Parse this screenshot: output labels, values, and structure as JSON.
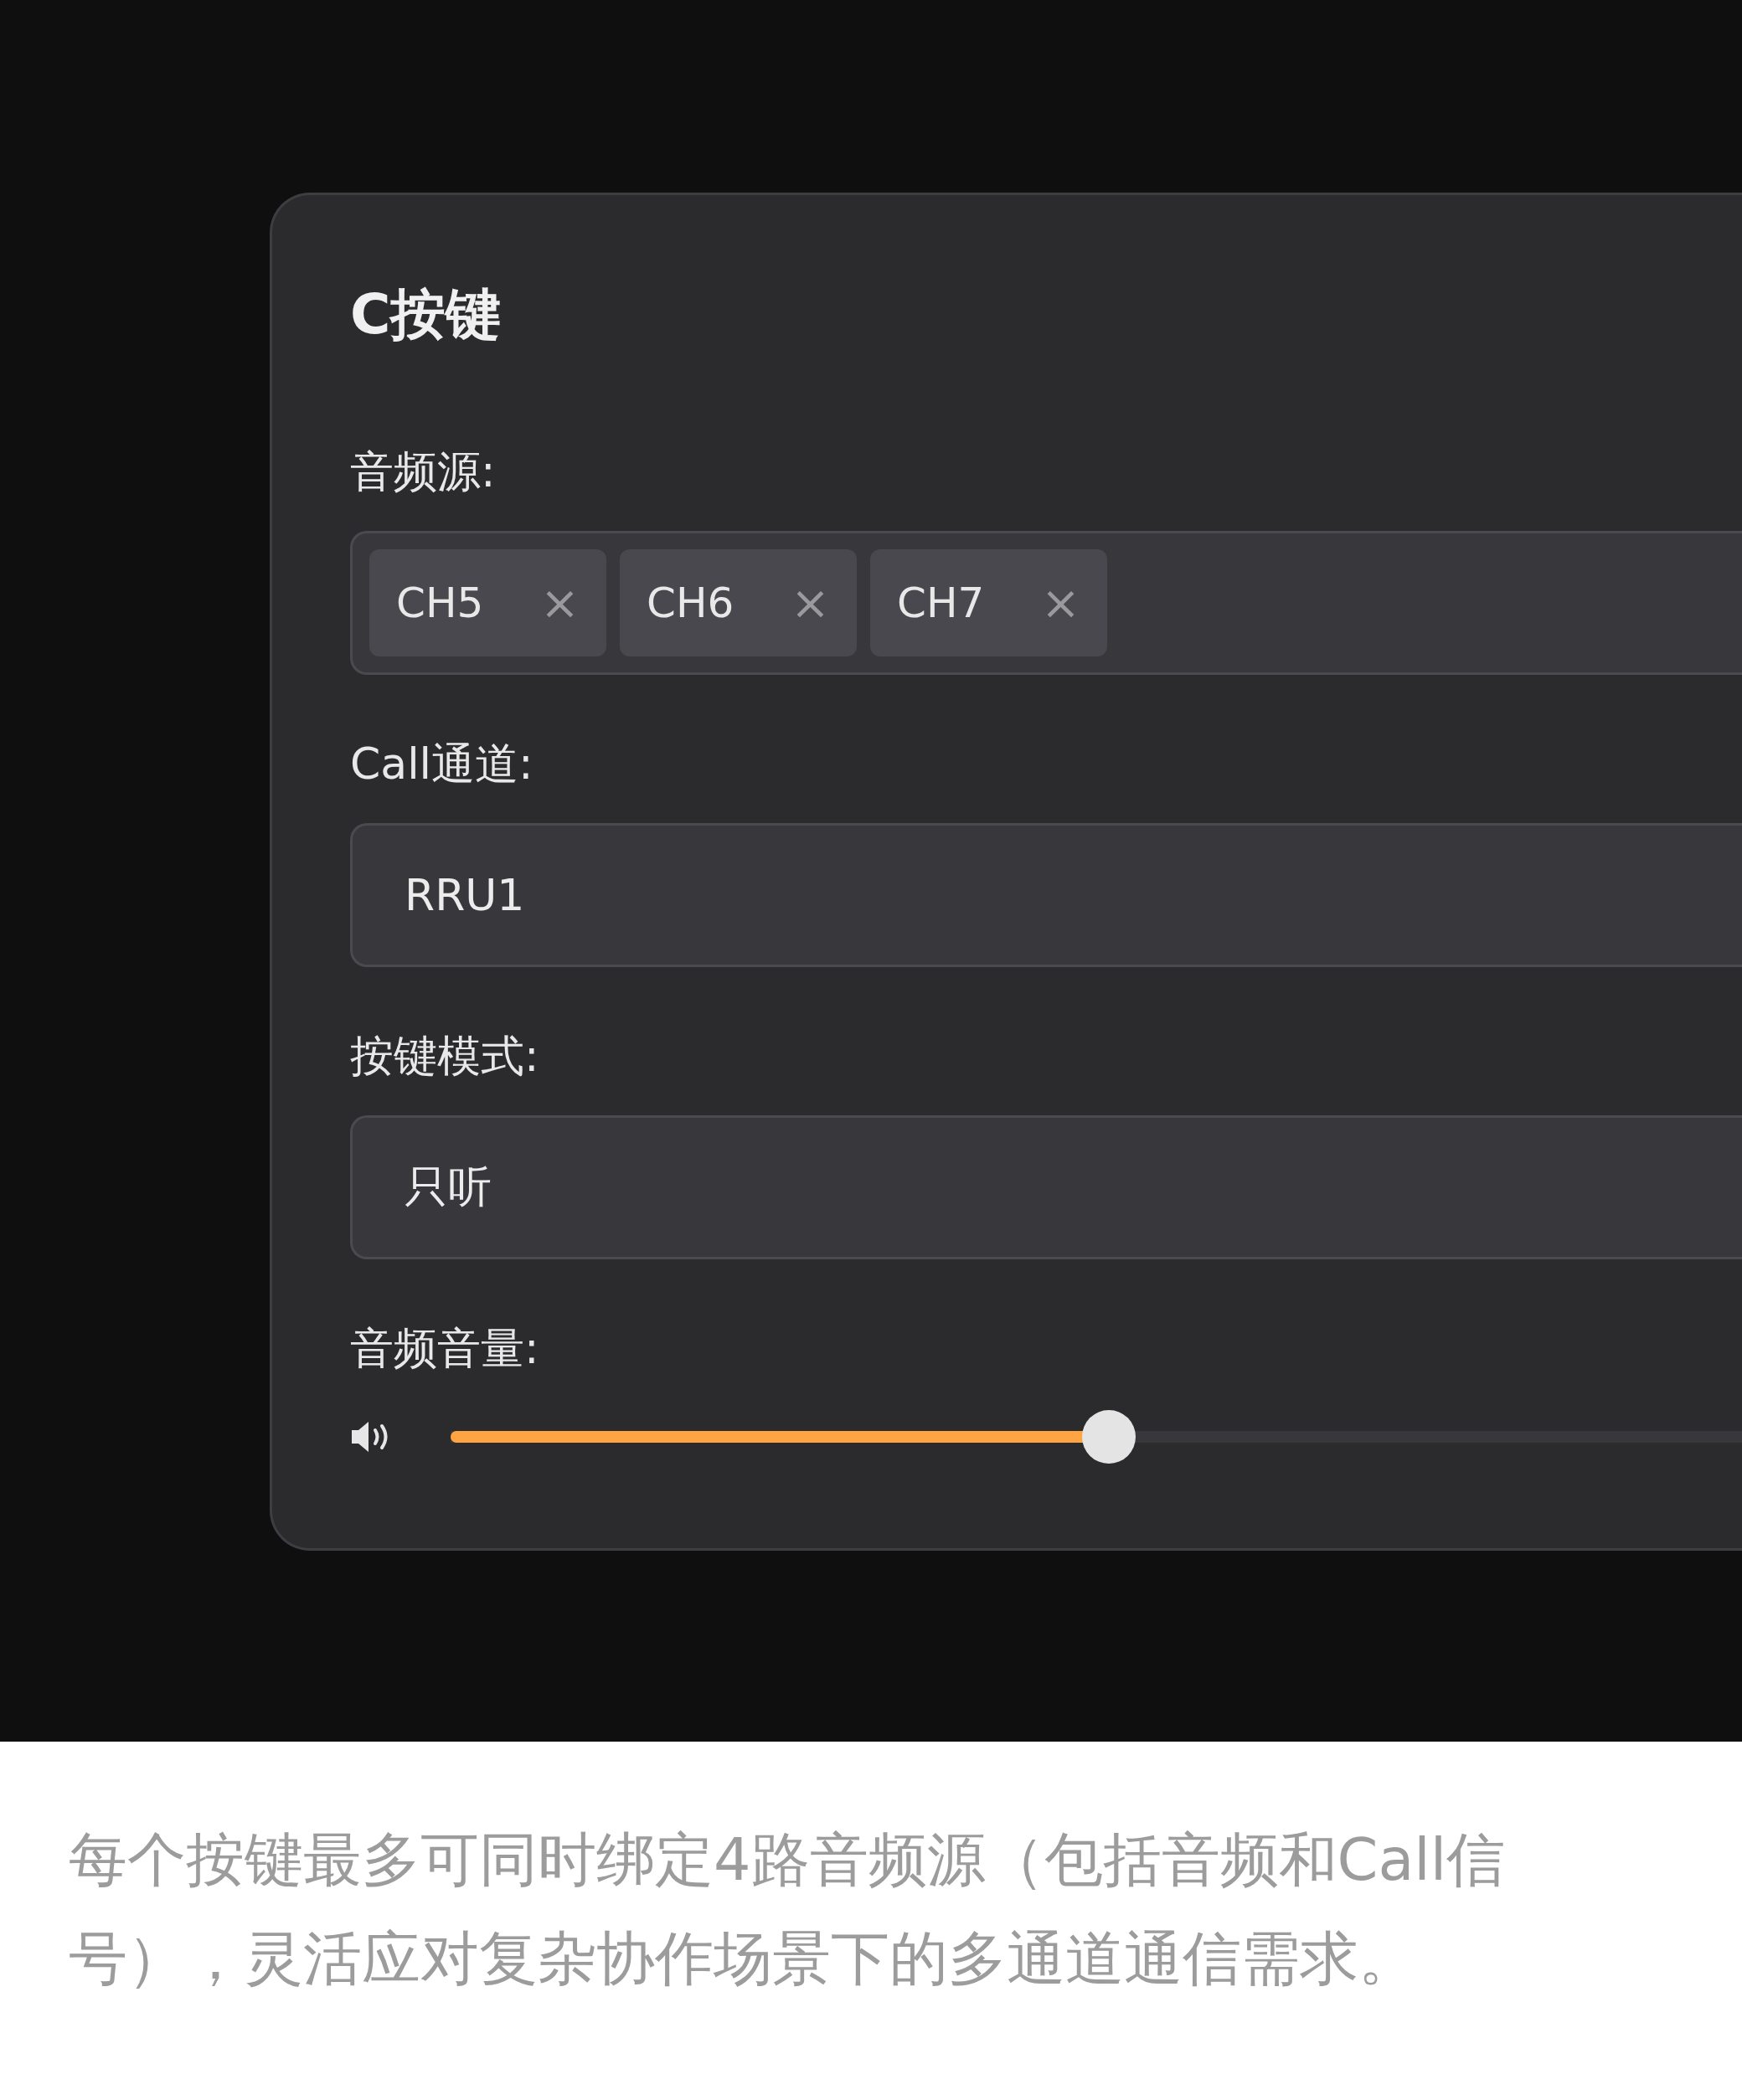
{
  "panel": {
    "title": "C按键",
    "audio_source": {
      "label": "音频源:",
      "tags": [
        {
          "text": "CH5",
          "remove": "×"
        },
        {
          "text": "CH6",
          "remove": "×"
        },
        {
          "text": "CH7",
          "remove": "×"
        }
      ]
    },
    "call_channel": {
      "label": "Call通道:",
      "value": "RRU1"
    },
    "key_mode": {
      "label": "按键模式:",
      "value": "只听"
    },
    "volume": {
      "label": "音频音量:",
      "level": 0.51
    }
  },
  "caption": "每个按键最多可同时绑定4路音频源（包括音频和Call信号），灵活应对复杂协作场景下的多通道通信需求。"
}
